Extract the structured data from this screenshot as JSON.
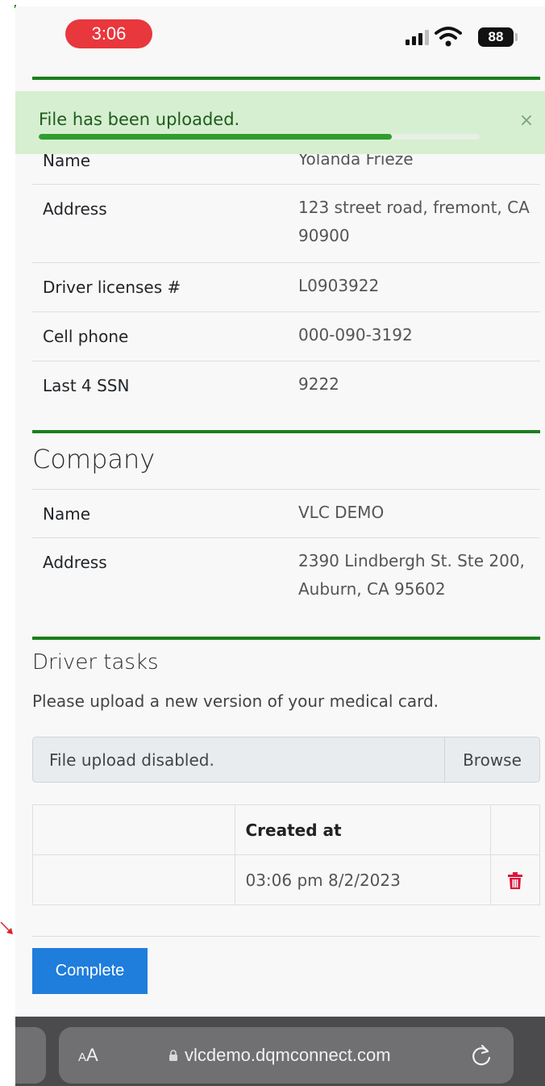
{
  "status_bar": {
    "time": "3:06",
    "battery": "88"
  },
  "toast": {
    "message": "File has been uploaded.",
    "close": "×",
    "progress": 0.8
  },
  "driver": {
    "rows": [
      {
        "label": "Name",
        "value": "Yolanda Frieze"
      },
      {
        "label": "Address",
        "value": "123 street road, fremont, CA 90900"
      },
      {
        "label": "Driver licenses #",
        "value": "L0903922"
      },
      {
        "label": "Cell phone",
        "value": "000-090-3192"
      },
      {
        "label": "Last 4 SSN",
        "value": "9222"
      }
    ]
  },
  "company": {
    "title": "Company",
    "rows": [
      {
        "label": "Name",
        "value": "VLC DEMO"
      },
      {
        "label": "Address",
        "value": "2390 Lindbergh St. Ste 200, Auburn, CA 95602"
      }
    ]
  },
  "tasks": {
    "title": "Driver tasks",
    "description": "Please upload a new version of your medical card.",
    "file_input_placeholder": "File upload disabled.",
    "browse_label": "Browse",
    "table": {
      "headers": [
        "",
        "Created at",
        ""
      ],
      "rows": [
        {
          "name": "",
          "created_at": "03:06 pm 8/2/2023"
        }
      ]
    },
    "complete_label": "Complete"
  },
  "browser": {
    "aa_label": "A",
    "aa_label_large": "A",
    "url": "vlcdemo.dqmconnect.com"
  },
  "colors": {
    "accent_green": "#1c7f1c",
    "primary_blue": "#1f7ddc",
    "danger_red": "#dc143c",
    "toast_bg": "#d6efd0"
  }
}
